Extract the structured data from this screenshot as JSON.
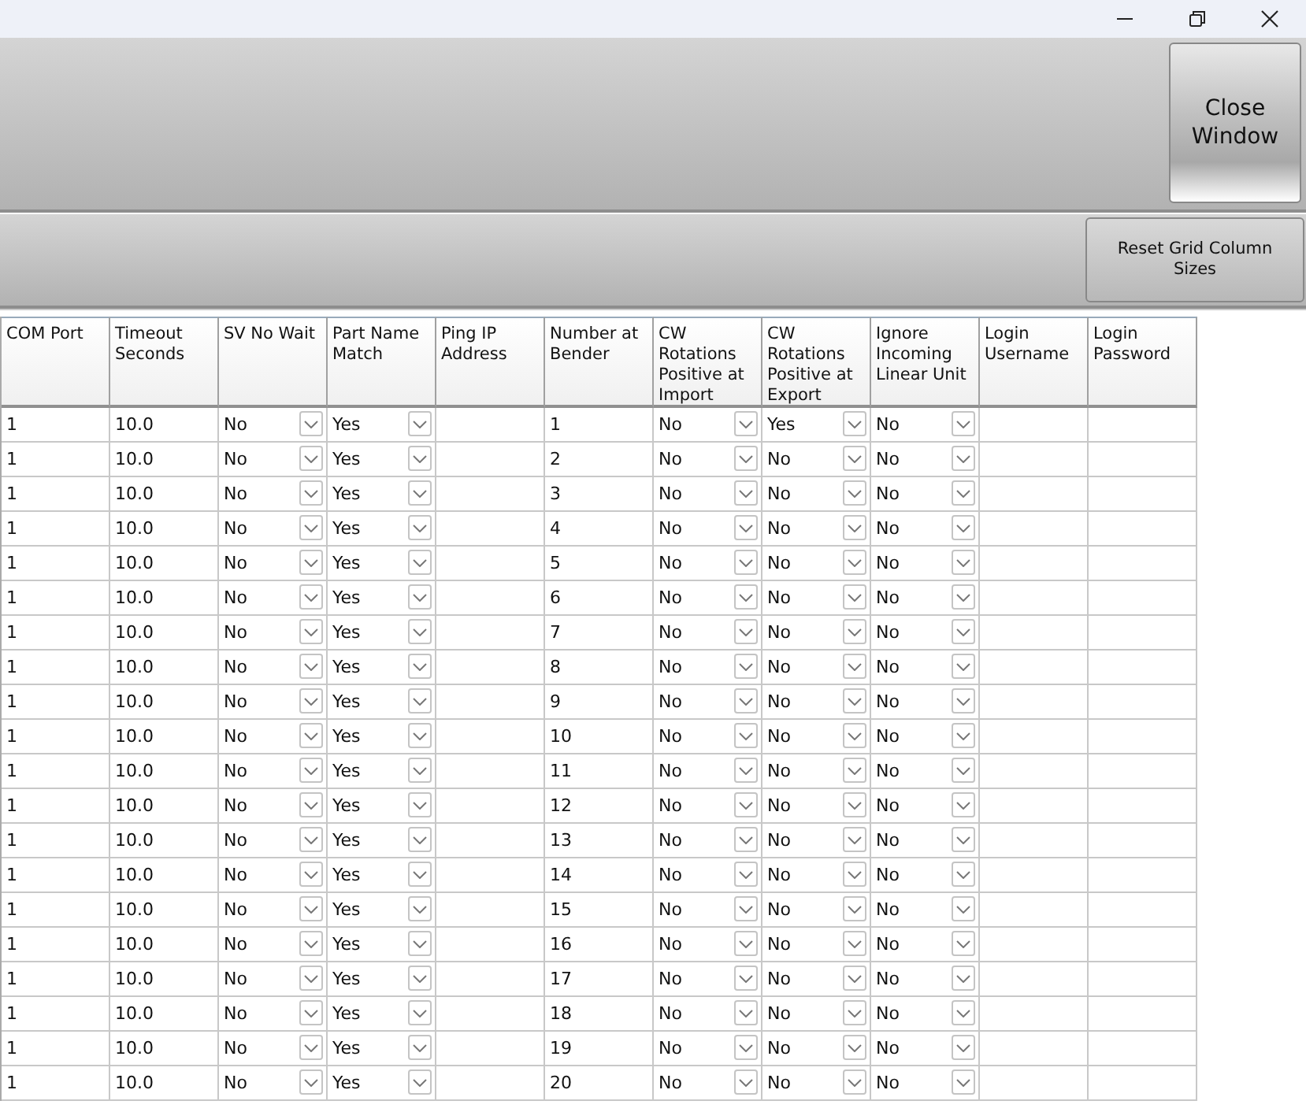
{
  "window": {
    "controls": [
      {
        "kind": "minimize"
      },
      {
        "kind": "restore"
      },
      {
        "kind": "close"
      }
    ]
  },
  "top_panel": {
    "button": "Close\nWindow"
  },
  "toolbar": {
    "button": "Reset Grid Column\nSizes"
  },
  "grid": {
    "columns": [
      {
        "label": "COM Port",
        "kind": "text"
      },
      {
        "label": "Timeout Seconds",
        "kind": "text"
      },
      {
        "label": "SV No Wait",
        "kind": "dropdown"
      },
      {
        "label": "Part Name Match",
        "kind": "dropdown"
      },
      {
        "label": "Ping IP Address",
        "kind": "text"
      },
      {
        "label": "Number at Bender",
        "kind": "text"
      },
      {
        "label": "CW Rotations Positive at Import",
        "kind": "dropdown"
      },
      {
        "label": "CW Rotations Positive at Export",
        "kind": "dropdown"
      },
      {
        "label": "Ignore Incoming Linear Unit",
        "kind": "dropdown"
      },
      {
        "label": "Login Username",
        "kind": "text"
      },
      {
        "label": "Login Password",
        "kind": "text"
      }
    ],
    "rows": [
      [
        "1",
        "10.0",
        "No",
        "Yes",
        "",
        "1",
        "No",
        "Yes",
        "No",
        "",
        ""
      ],
      [
        "1",
        "10.0",
        "No",
        "Yes",
        "",
        "2",
        "No",
        "No",
        "No",
        "",
        ""
      ],
      [
        "1",
        "10.0",
        "No",
        "Yes",
        "",
        "3",
        "No",
        "No",
        "No",
        "",
        ""
      ],
      [
        "1",
        "10.0",
        "No",
        "Yes",
        "",
        "4",
        "No",
        "No",
        "No",
        "",
        ""
      ],
      [
        "1",
        "10.0",
        "No",
        "Yes",
        "",
        "5",
        "No",
        "No",
        "No",
        "",
        ""
      ],
      [
        "1",
        "10.0",
        "No",
        "Yes",
        "",
        "6",
        "No",
        "No",
        "No",
        "",
        ""
      ],
      [
        "1",
        "10.0",
        "No",
        "Yes",
        "",
        "7",
        "No",
        "No",
        "No",
        "",
        ""
      ],
      [
        "1",
        "10.0",
        "No",
        "Yes",
        "",
        "8",
        "No",
        "No",
        "No",
        "",
        ""
      ],
      [
        "1",
        "10.0",
        "No",
        "Yes",
        "",
        "9",
        "No",
        "No",
        "No",
        "",
        ""
      ],
      [
        "1",
        "10.0",
        "No",
        "Yes",
        "",
        "10",
        "No",
        "No",
        "No",
        "",
        ""
      ],
      [
        "1",
        "10.0",
        "No",
        "Yes",
        "",
        "11",
        "No",
        "No",
        "No",
        "",
        ""
      ],
      [
        "1",
        "10.0",
        "No",
        "Yes",
        "",
        "12",
        "No",
        "No",
        "No",
        "",
        ""
      ],
      [
        "1",
        "10.0",
        "No",
        "Yes",
        "",
        "13",
        "No",
        "No",
        "No",
        "",
        ""
      ],
      [
        "1",
        "10.0",
        "No",
        "Yes",
        "",
        "14",
        "No",
        "No",
        "No",
        "",
        ""
      ],
      [
        "1",
        "10.0",
        "No",
        "Yes",
        "",
        "15",
        "No",
        "No",
        "No",
        "",
        ""
      ],
      [
        "1",
        "10.0",
        "No",
        "Yes",
        "",
        "16",
        "No",
        "No",
        "No",
        "",
        ""
      ],
      [
        "1",
        "10.0",
        "No",
        "Yes",
        "",
        "17",
        "No",
        "No",
        "No",
        "",
        ""
      ],
      [
        "1",
        "10.0",
        "No",
        "Yes",
        "",
        "18",
        "No",
        "No",
        "No",
        "",
        ""
      ],
      [
        "1",
        "10.0",
        "No",
        "Yes",
        "",
        "19",
        "No",
        "No",
        "No",
        "",
        ""
      ],
      [
        "1",
        "10.0",
        "No",
        "Yes",
        "",
        "20",
        "No",
        "No",
        "No",
        "",
        ""
      ]
    ]
  }
}
